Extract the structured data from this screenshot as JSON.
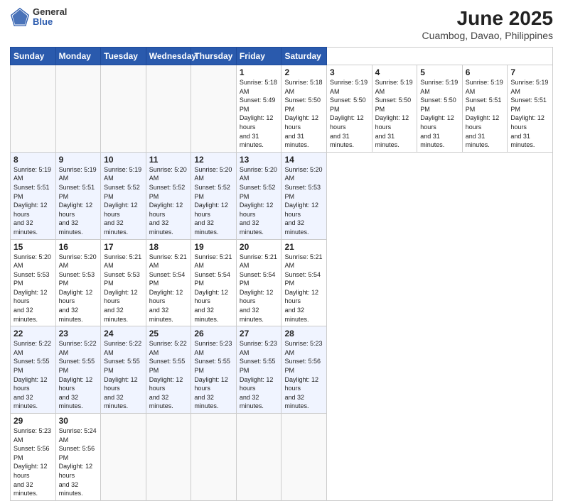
{
  "header": {
    "logo_line1": "General",
    "logo_line2": "Blue",
    "title": "June 2025",
    "subtitle": "Cuambog, Davao, Philippines"
  },
  "calendar": {
    "days_of_week": [
      "Sunday",
      "Monday",
      "Tuesday",
      "Wednesday",
      "Thursday",
      "Friday",
      "Saturday"
    ],
    "weeks": [
      [
        null,
        null,
        null,
        null,
        null,
        {
          "day": 1,
          "sunrise": "5:18 AM",
          "sunset": "5:49 PM",
          "daylight": "12 hours and 31 minutes."
        },
        {
          "day": 2,
          "sunrise": "5:18 AM",
          "sunset": "5:50 PM",
          "daylight": "12 hours and 31 minutes."
        },
        {
          "day": 3,
          "sunrise": "5:19 AM",
          "sunset": "5:50 PM",
          "daylight": "12 hours and 31 minutes."
        },
        {
          "day": 4,
          "sunrise": "5:19 AM",
          "sunset": "5:50 PM",
          "daylight": "12 hours and 31 minutes."
        },
        {
          "day": 5,
          "sunrise": "5:19 AM",
          "sunset": "5:50 PM",
          "daylight": "12 hours and 31 minutes."
        },
        {
          "day": 6,
          "sunrise": "5:19 AM",
          "sunset": "5:51 PM",
          "daylight": "12 hours and 31 minutes."
        },
        {
          "day": 7,
          "sunrise": "5:19 AM",
          "sunset": "5:51 PM",
          "daylight": "12 hours and 31 minutes."
        }
      ],
      [
        {
          "day": 8,
          "sunrise": "5:19 AM",
          "sunset": "5:51 PM",
          "daylight": "12 hours and 32 minutes."
        },
        {
          "day": 9,
          "sunrise": "5:19 AM",
          "sunset": "5:51 PM",
          "daylight": "12 hours and 32 minutes."
        },
        {
          "day": 10,
          "sunrise": "5:19 AM",
          "sunset": "5:52 PM",
          "daylight": "12 hours and 32 minutes."
        },
        {
          "day": 11,
          "sunrise": "5:20 AM",
          "sunset": "5:52 PM",
          "daylight": "12 hours and 32 minutes."
        },
        {
          "day": 12,
          "sunrise": "5:20 AM",
          "sunset": "5:52 PM",
          "daylight": "12 hours and 32 minutes."
        },
        {
          "day": 13,
          "sunrise": "5:20 AM",
          "sunset": "5:52 PM",
          "daylight": "12 hours and 32 minutes."
        },
        {
          "day": 14,
          "sunrise": "5:20 AM",
          "sunset": "5:53 PM",
          "daylight": "12 hours and 32 minutes."
        }
      ],
      [
        {
          "day": 15,
          "sunrise": "5:20 AM",
          "sunset": "5:53 PM",
          "daylight": "12 hours and 32 minutes."
        },
        {
          "day": 16,
          "sunrise": "5:20 AM",
          "sunset": "5:53 PM",
          "daylight": "12 hours and 32 minutes."
        },
        {
          "day": 17,
          "sunrise": "5:21 AM",
          "sunset": "5:53 PM",
          "daylight": "12 hours and 32 minutes."
        },
        {
          "day": 18,
          "sunrise": "5:21 AM",
          "sunset": "5:54 PM",
          "daylight": "12 hours and 32 minutes."
        },
        {
          "day": 19,
          "sunrise": "5:21 AM",
          "sunset": "5:54 PM",
          "daylight": "12 hours and 32 minutes."
        },
        {
          "day": 20,
          "sunrise": "5:21 AM",
          "sunset": "5:54 PM",
          "daylight": "12 hours and 32 minutes."
        },
        {
          "day": 21,
          "sunrise": "5:21 AM",
          "sunset": "5:54 PM",
          "daylight": "12 hours and 32 minutes."
        }
      ],
      [
        {
          "day": 22,
          "sunrise": "5:22 AM",
          "sunset": "5:55 PM",
          "daylight": "12 hours and 32 minutes."
        },
        {
          "day": 23,
          "sunrise": "5:22 AM",
          "sunset": "5:55 PM",
          "daylight": "12 hours and 32 minutes."
        },
        {
          "day": 24,
          "sunrise": "5:22 AM",
          "sunset": "5:55 PM",
          "daylight": "12 hours and 32 minutes."
        },
        {
          "day": 25,
          "sunrise": "5:22 AM",
          "sunset": "5:55 PM",
          "daylight": "12 hours and 32 minutes."
        },
        {
          "day": 26,
          "sunrise": "5:23 AM",
          "sunset": "5:55 PM",
          "daylight": "12 hours and 32 minutes."
        },
        {
          "day": 27,
          "sunrise": "5:23 AM",
          "sunset": "5:55 PM",
          "daylight": "12 hours and 32 minutes."
        },
        {
          "day": 28,
          "sunrise": "5:23 AM",
          "sunset": "5:56 PM",
          "daylight": "12 hours and 32 minutes."
        }
      ],
      [
        {
          "day": 29,
          "sunrise": "5:23 AM",
          "sunset": "5:56 PM",
          "daylight": "12 hours and 32 minutes."
        },
        {
          "day": 30,
          "sunrise": "5:24 AM",
          "sunset": "5:56 PM",
          "daylight": "12 hours and 32 minutes."
        },
        null,
        null,
        null,
        null,
        null
      ]
    ]
  }
}
